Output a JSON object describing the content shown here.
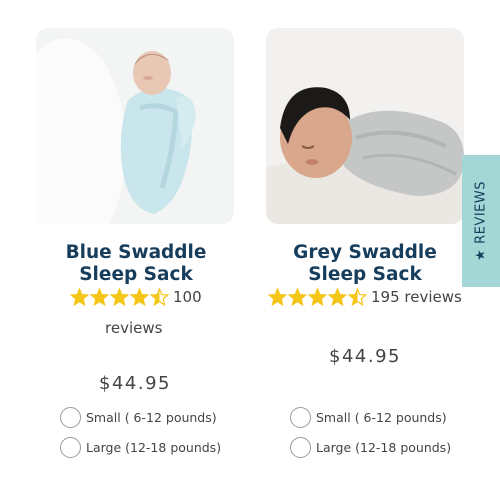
{
  "products": [
    {
      "title_line1": "Blue Swaddle",
      "title_line2": "Sleep Sack",
      "rating": 4.5,
      "rating_text": "100",
      "reviews_word": "reviews",
      "price": "$44.95",
      "options": [
        "Small ( 6-12 pounds)",
        "Large (12-18 pounds)"
      ]
    },
    {
      "title_line1": "Grey Swaddle",
      "title_line2": "Sleep Sack",
      "rating": 4.5,
      "rating_text": "195 reviews",
      "price": "$44.95",
      "options": [
        "Small ( 6-12 pounds)",
        "Large (12-18 pounds)"
      ]
    }
  ],
  "reviews_tab": {
    "label": "REVIEWS",
    "icon": "star-icon"
  },
  "colors": {
    "title": "#173d5c",
    "star": "#f5c518",
    "tab_bg": "#a3d7d6"
  }
}
